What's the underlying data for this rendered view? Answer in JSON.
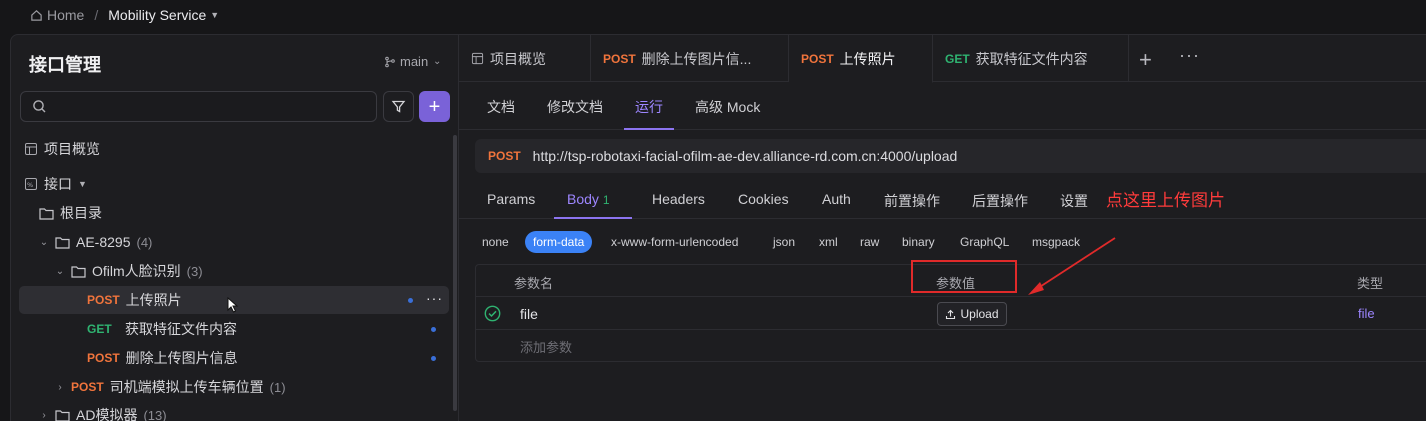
{
  "breadcrumb": {
    "home": "Home",
    "separator": "/",
    "service": "Mobility Service"
  },
  "sidebar": {
    "title": "接口管理",
    "branch": "main",
    "search_placeholder": "",
    "nav": {
      "overview": "项目概览",
      "interfaces": "接口"
    },
    "tree": [
      {
        "label": "根目录"
      },
      {
        "label": "AE-8295",
        "count": "(4)"
      },
      {
        "label": "Ofilm人脸识别",
        "count": "(3)"
      },
      {
        "method": "POST",
        "label": "上传照片"
      },
      {
        "method": "GET",
        "label": "获取特征文件内容"
      },
      {
        "method": "POST",
        "label": "删除上传图片信息"
      },
      {
        "method": "POST",
        "label": "司机端模拟上传车辆位置",
        "count": "(1)"
      },
      {
        "label": "AD模拟器",
        "count": "(13)"
      }
    ]
  },
  "tabs": [
    {
      "label": "项目概览"
    },
    {
      "method": "POST",
      "label": "删除上传图片信..."
    },
    {
      "method": "POST",
      "label": "上传照片"
    },
    {
      "method": "GET",
      "label": "获取特征文件内容"
    }
  ],
  "subtabs": [
    "文档",
    "修改文档",
    "运行",
    "高级 Mock"
  ],
  "request": {
    "method": "POST",
    "url": "http://tsp-robotaxi-facial-ofilm-ae-dev.alliance-rd.com.cn:4000/upload"
  },
  "request_tabs": {
    "params": "Params",
    "body": "Body",
    "body_count": "1",
    "headers": "Headers",
    "cookies": "Cookies",
    "auth": "Auth",
    "pre": "前置操作",
    "post": "后置操作",
    "settings": "设置"
  },
  "body_types": [
    "none",
    "form-data",
    "x-www-form-urlencoded",
    "json",
    "xml",
    "raw",
    "binary",
    "GraphQL",
    "msgpack"
  ],
  "params_table": {
    "headers": {
      "name": "参数名",
      "value": "参数值",
      "type": "类型"
    },
    "rows": [
      {
        "name": "file",
        "value_button": "Upload",
        "type": "file"
      }
    ],
    "add_label": "添加参数"
  },
  "annotation": {
    "text": "点这里上传图片",
    "color": "#e02a2a"
  },
  "colors": {
    "accent": "#8c74f0",
    "post": "#f0743c",
    "get": "#2fb371",
    "active_chip": "#3b82f6"
  }
}
